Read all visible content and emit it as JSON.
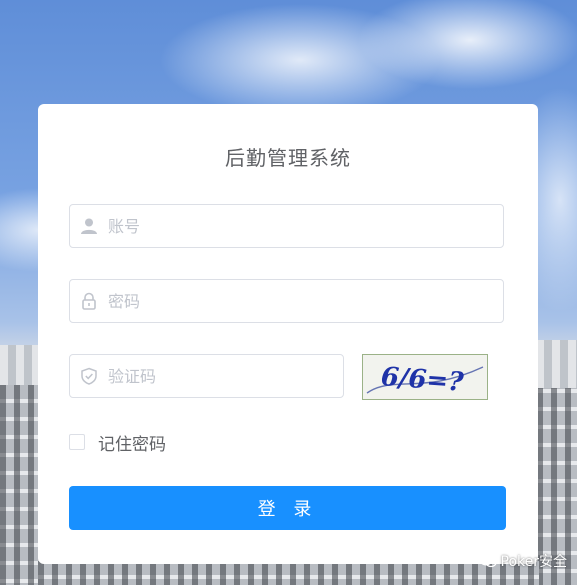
{
  "app": {
    "title": "后勤管理系统"
  },
  "form": {
    "account_placeholder": "账号",
    "password_placeholder": "密码",
    "captcha_placeholder": "验证码",
    "captcha_text": "6/6=?",
    "remember_label": "记住密码",
    "remember_checked": false,
    "login_label": "登 录"
  },
  "watermark": {
    "text": "Poker安全",
    "icon": "wechat-icon"
  },
  "colors": {
    "primary": "#1890ff",
    "title": "#606266",
    "placeholder": "#c0c4cc",
    "border": "#dcdfe6"
  }
}
